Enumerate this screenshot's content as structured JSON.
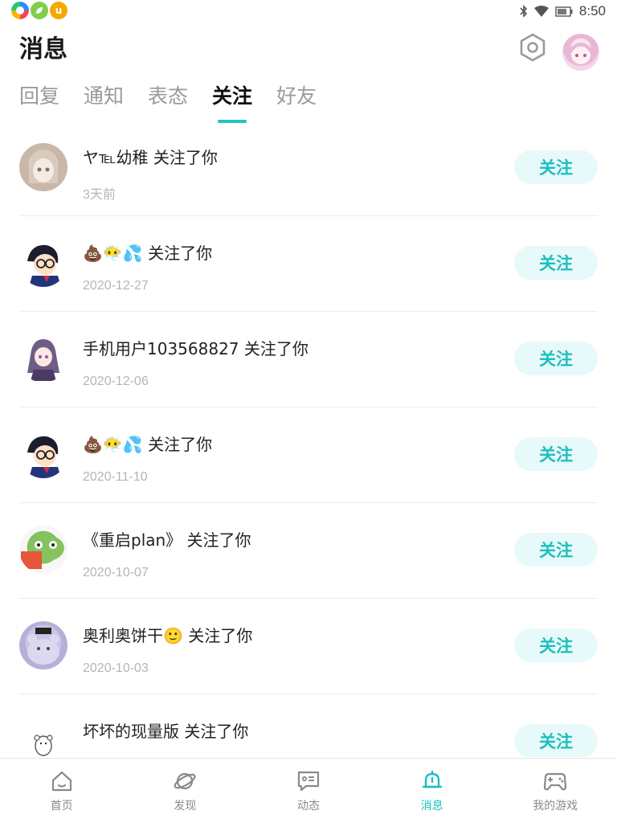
{
  "status_bar": {
    "time": "8:50",
    "app_icons": [
      "multicolor-app-icon",
      "leaf-app-icon",
      "u-app-icon"
    ],
    "u_app_letter": "u",
    "indicators": [
      "bluetooth-icon",
      "wifi-icon",
      "battery-icon"
    ]
  },
  "header": {
    "title": "消息"
  },
  "tabs": [
    {
      "label": "回复",
      "active": false
    },
    {
      "label": "通知",
      "active": false
    },
    {
      "label": "表态",
      "active": false
    },
    {
      "label": "关注",
      "active": true
    },
    {
      "label": "好友",
      "active": false
    }
  ],
  "items": [
    {
      "message": "ヤ℡幼稚 关注了你",
      "time": "3天前",
      "button": "关注"
    },
    {
      "message": "💩😶‍🌫️💦 关注了你",
      "time": "2020-12-27",
      "button": "关注"
    },
    {
      "message": "手机用户103568827 关注了你",
      "time": "2020-12-06",
      "button": "关注"
    },
    {
      "message": "💩😶‍🌫️💦 关注了你",
      "time": "2020-11-10",
      "button": "关注"
    },
    {
      "message": "《重启plan》 关注了你",
      "time": "2020-10-07",
      "button": "关注"
    },
    {
      "message": "奥利奥饼干🙂 关注了你",
      "time": "2020-10-03",
      "button": "关注"
    },
    {
      "message": "坏坏的现量版 关注了你",
      "time": "",
      "button": "关注"
    }
  ],
  "bottom_nav": [
    {
      "label": "首页",
      "icon": "home-icon",
      "active": false
    },
    {
      "label": "发现",
      "icon": "planet-icon",
      "active": false
    },
    {
      "label": "动态",
      "icon": "feed-icon",
      "active": false
    },
    {
      "label": "消息",
      "icon": "bell-icon",
      "active": true
    },
    {
      "label": "我的游戏",
      "icon": "gamepad-icon",
      "active": false
    }
  ],
  "colors": {
    "accent": "#1bbfc0",
    "follow_bg": "#e8f9f9",
    "muted_text": "#9a9a9a"
  }
}
